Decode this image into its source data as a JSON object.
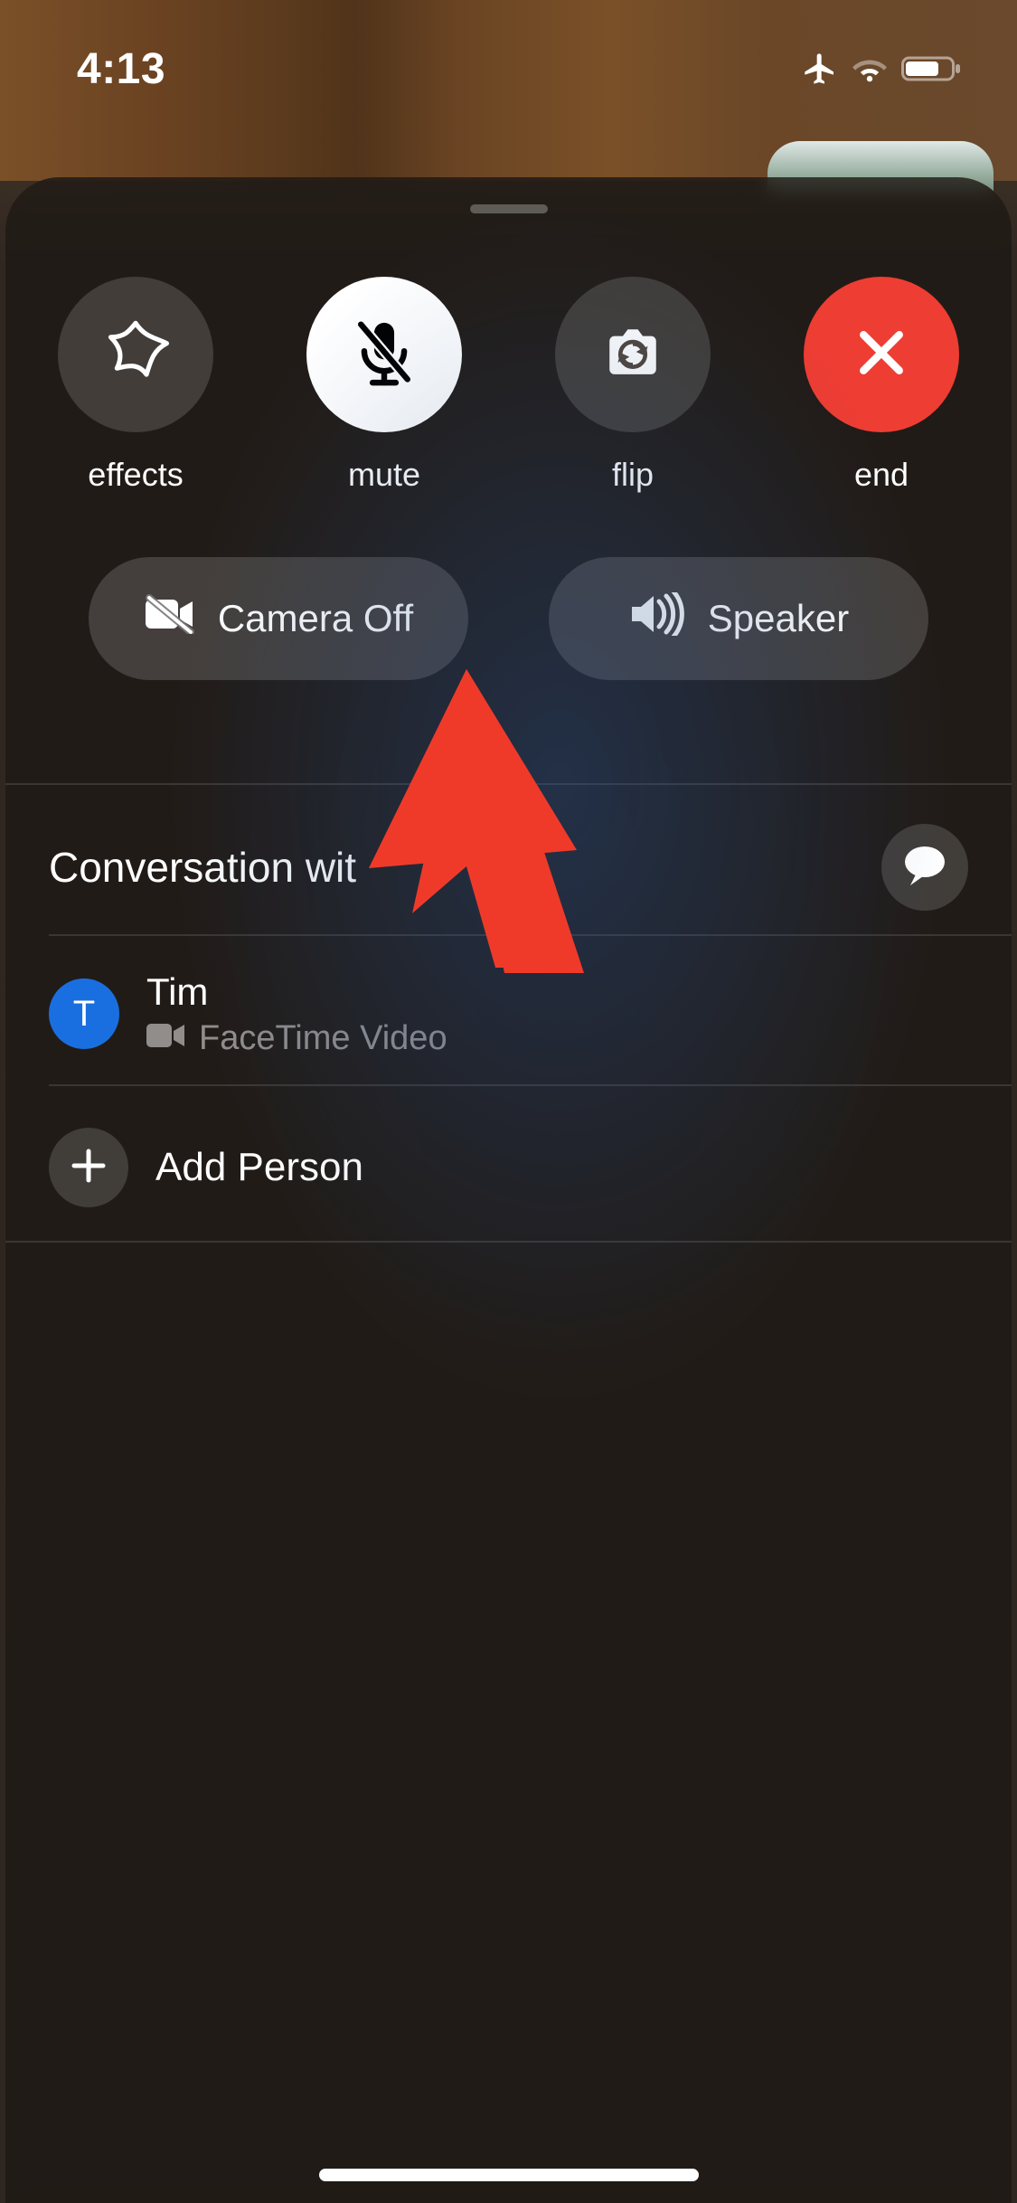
{
  "status": {
    "time": "4:13"
  },
  "controls": {
    "effects": {
      "label": "effects"
    },
    "mute": {
      "label": "mute"
    },
    "flip": {
      "label": "flip"
    },
    "end": {
      "label": "end"
    }
  },
  "pills": {
    "camera_off": {
      "label": "Camera Off"
    },
    "speaker": {
      "label": "Speaker"
    }
  },
  "section": {
    "title_visible": "Conversation wit"
  },
  "participant": {
    "initial": "T",
    "name": "Tim",
    "status": "FaceTime Video"
  },
  "add_person": {
    "label": "Add Person"
  }
}
